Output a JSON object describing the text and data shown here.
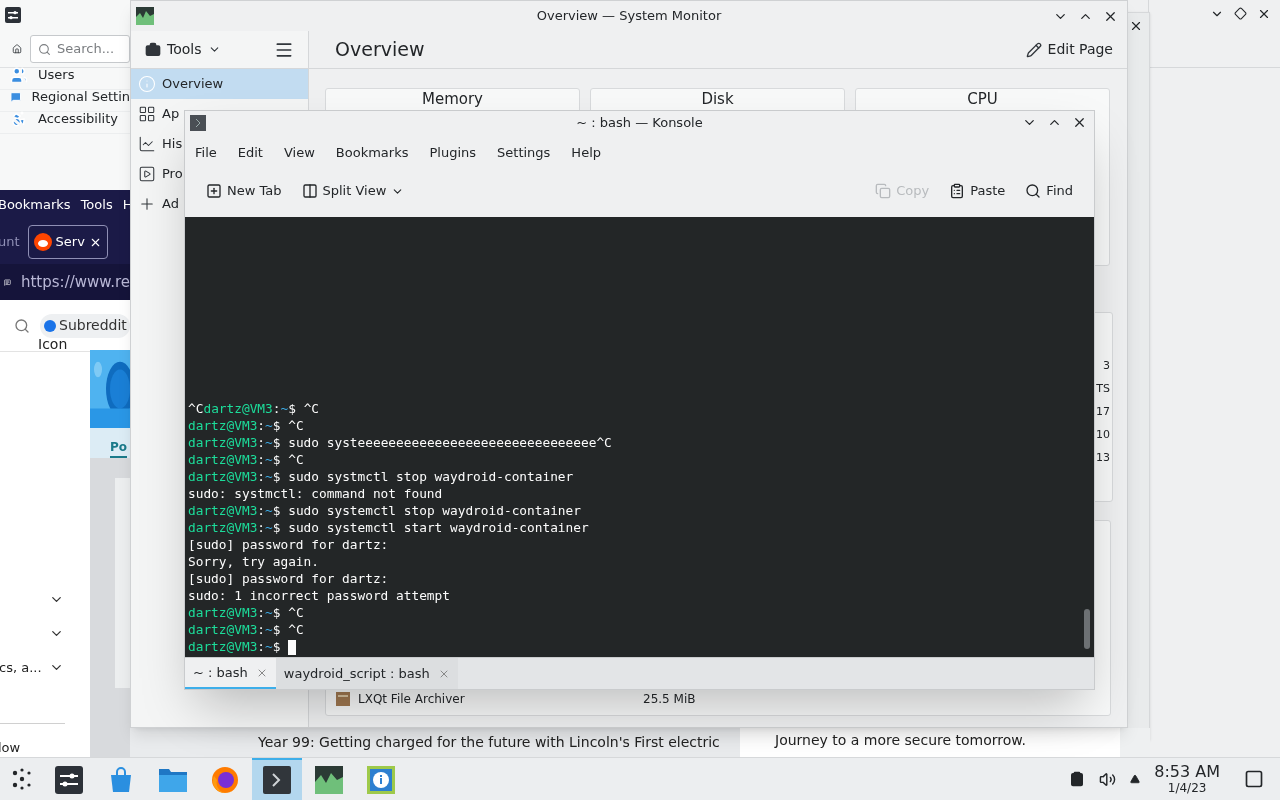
{
  "settings_window": {
    "search": {
      "placeholder": "Search..."
    },
    "items": [
      {
        "label": "Users",
        "kind": "users"
      },
      {
        "label": "Regional Settin",
        "kind": "regional"
      },
      {
        "label": "Accessibility",
        "kind": "accessibility"
      }
    ]
  },
  "browser_window": {
    "menu": [
      "Bookmarks",
      "Tools",
      "H"
    ],
    "tabs": [
      {
        "label": "unt",
        "selected": false
      },
      {
        "label": "Serv",
        "selected": true
      }
    ],
    "url": "https://www.re",
    "search_text": "Subreddit",
    "search_caption": "Icon",
    "banner_tab": "Po",
    "expandable_rows": [
      {
        "expanded": false
      },
      {
        "expanded": false
      },
      {
        "expanded": false,
        "label": "cs, a..."
      }
    ],
    "footer_text": "low",
    "headlines": [
      "Year 99: Getting charged for the future with Lincoln's First electric",
      "Journey to a more secure tomorrow."
    ]
  },
  "system_monitor": {
    "title": "Overview — System Monitor",
    "tools_label": "Tools",
    "pages": [
      {
        "label": "Overview",
        "kind": "overview",
        "selected": true
      },
      {
        "label": "Ap",
        "kind": "applications",
        "selected": false
      },
      {
        "label": "His",
        "kind": "history",
        "selected": false
      },
      {
        "label": "Pro",
        "kind": "processes",
        "selected": false
      },
      {
        "label": "Ad",
        "kind": "add",
        "selected": false
      }
    ],
    "page_title": "Overview",
    "edit_button": "Edit Page",
    "cards": [
      "Memory",
      "Disk",
      "CPU"
    ],
    "table_fragments": [
      "3",
      "TS",
      "17",
      "10",
      "13"
    ],
    "process_row": {
      "name": "LXQt File Archiver",
      "memory": "25.5 MiB"
    }
  },
  "konsole": {
    "title": "~ : bash — Konsole",
    "menu": [
      "File",
      "Edit",
      "View",
      "Bookmarks",
      "Plugins",
      "Settings",
      "Help"
    ],
    "toolbar": [
      {
        "label": "New Tab",
        "kind": "new-tab",
        "disabled": false
      },
      {
        "label": "Split View",
        "kind": "split-view",
        "disabled": false
      },
      {
        "label": "Copy",
        "kind": "copy",
        "disabled": true
      },
      {
        "label": "Paste",
        "kind": "paste",
        "disabled": false
      },
      {
        "label": "Find",
        "kind": "find",
        "disabled": false
      }
    ],
    "lines": [
      {
        "kind": "prompt",
        "before": "^C",
        "user": "dartz@VM3",
        "sep": ":",
        "path": "~",
        "sign": "$",
        "command": "^C"
      },
      {
        "kind": "prompt",
        "user": "dartz@VM3",
        "sep": ":",
        "path": "~",
        "sign": "$",
        "command": "^C"
      },
      {
        "kind": "prompt",
        "user": "dartz@VM3",
        "sep": ":",
        "path": "~",
        "sign": "$",
        "command": "sudo systeeeeeeeeeeeeeeeeeeeeeeeeeeeeeee^C"
      },
      {
        "kind": "prompt",
        "user": "dartz@VM3",
        "sep": ":",
        "path": "~",
        "sign": "$",
        "command": "^C"
      },
      {
        "kind": "prompt",
        "user": "dartz@VM3",
        "sep": ":",
        "path": "~",
        "sign": "$",
        "command": "sudo systmctl stop waydroid-container"
      },
      {
        "kind": "output",
        "text": "sudo: systmctl: command not found"
      },
      {
        "kind": "prompt",
        "user": "dartz@VM3",
        "sep": ":",
        "path": "~",
        "sign": "$",
        "command": "sudo systemctl stop waydroid-container"
      },
      {
        "kind": "prompt",
        "user": "dartz@VM3",
        "sep": ":",
        "path": "~",
        "sign": "$",
        "command": "sudo systemctl start waydroid-container"
      },
      {
        "kind": "output",
        "text": "[sudo] password for dartz:"
      },
      {
        "kind": "output",
        "text": "Sorry, try again."
      },
      {
        "kind": "output",
        "text": "[sudo] password for dartz:"
      },
      {
        "kind": "output",
        "text": "sudo: 1 incorrect password attempt"
      },
      {
        "kind": "prompt",
        "user": "dartz@VM3",
        "sep": ":",
        "path": "~",
        "sign": "$",
        "command": "^C"
      },
      {
        "kind": "prompt",
        "user": "dartz@VM3",
        "sep": ":",
        "path": "~",
        "sign": "$",
        "command": "^C"
      },
      {
        "kind": "prompt",
        "user": "dartz@VM3",
        "sep": ":",
        "path": "~",
        "sign": "$",
        "cursor": true
      }
    ],
    "tabs": [
      {
        "label": "~ : bash",
        "selected": true
      },
      {
        "label": "waydroid_script : bash",
        "selected": false
      }
    ]
  },
  "taskbar": {
    "apps": [
      {
        "kind": "settings",
        "selected": false
      },
      {
        "kind": "store",
        "selected": false
      },
      {
        "kind": "files",
        "selected": false
      },
      {
        "kind": "browser",
        "selected": false
      },
      {
        "kind": "terminal",
        "selected": true
      },
      {
        "kind": "monitor",
        "selected": false
      },
      {
        "kind": "info",
        "selected": false
      }
    ],
    "clock": {
      "time": "8:53 AM",
      "date": "1/4/23"
    }
  }
}
